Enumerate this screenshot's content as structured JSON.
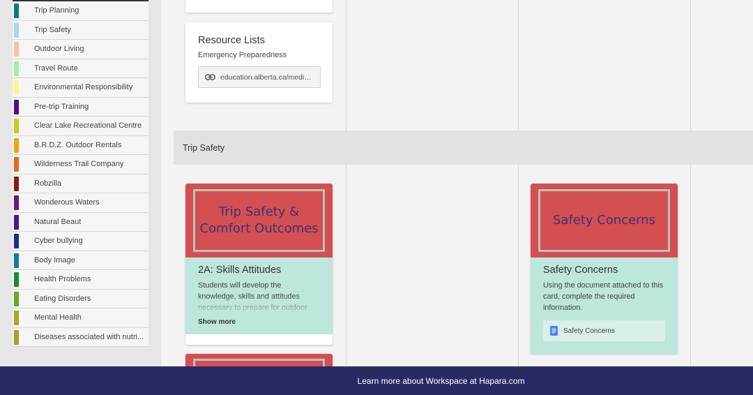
{
  "sidebar": {
    "tags": [
      {
        "label": "Trip Planning",
        "color": "#0f7a78"
      },
      {
        "label": "Trip Safety",
        "color": "#a8d8f2"
      },
      {
        "label": "Outdoor Living",
        "color": "#f7c1a6"
      },
      {
        "label": "Travel Route",
        "color": "#9ef2a3"
      },
      {
        "label": "Environmental Responsibility",
        "color": "#fbf78a"
      },
      {
        "label": "Pre-trip Training",
        "color": "#4b1187"
      },
      {
        "label": "Clear Lake Recreational Centre",
        "color": "#c8cc14"
      },
      {
        "label": "B.R.D.Z. Outdoor Rentals",
        "color": "#f0a119"
      },
      {
        "label": "Wilderness Trail Company",
        "color": "#e8661d"
      },
      {
        "label": "Robzilla",
        "color": "#8a1a1a"
      },
      {
        "label": "Wonderous Waters",
        "color": "#6b1679"
      },
      {
        "label": "Natural Beaut",
        "color": "#4a168e"
      },
      {
        "label": "Cyber bullying",
        "color": "#1e2a8e"
      },
      {
        "label": "Body Image",
        "color": "#0f7aa0"
      },
      {
        "label": "Health Problems",
        "color": "#1b8a32"
      },
      {
        "label": "Eating Disorders",
        "color": "#6fa421"
      },
      {
        "label": "Mental Health",
        "color": "#a4a824"
      },
      {
        "label": "Diseases associated with nutri...",
        "color": "#9ea323"
      }
    ]
  },
  "board": {
    "resource_card": {
      "title": "Resource Lists",
      "subtitle": "Emergency Preparedness",
      "link_text": "education.alberta.ca/media...",
      "link_icon": "link-icon"
    },
    "row_header": "Trip Safety",
    "skills_card": {
      "image_text": "Trip Safety & Comfort Outcomes",
      "title": "2A: Skills Attitudes",
      "description": "Students will develop the knowledge, skills and attitudes necessary to prepare for outdoor expeditions in ways that will",
      "show_more": "Show more",
      "image_color": "#d44f51",
      "body_color": "#bde6dc"
    },
    "safety_card": {
      "image_text": "Safety Concerns",
      "title": "Safety Concerns",
      "description": "Using the document attached to this card, complete the required information.",
      "doc_label": "Safety Concerns",
      "doc_icon": "google-doc-icon"
    }
  },
  "footer": {
    "text": "Learn more about Workspace at Hapara.com",
    "color": "#2a2a63"
  }
}
